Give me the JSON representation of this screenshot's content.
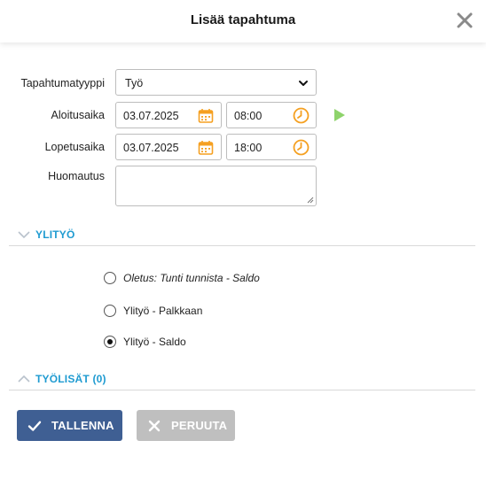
{
  "dialog": {
    "title": "Lisää tapahtuma",
    "close_icon": "close-icon"
  },
  "form": {
    "event_type_label": "Tapahtumatyyppi",
    "event_type_value": "Työ",
    "start_label": "Aloitusaika",
    "start_date": "03.07.2025",
    "start_time": "08:00",
    "end_label": "Lopetusaika",
    "end_date": "03.07.2025",
    "end_time": "18:00",
    "note_label": "Huomautus",
    "note_value": ""
  },
  "overtime": {
    "title": "YLITYÖ",
    "options": [
      {
        "label": "Oletus: Tunti tunnista - Saldo",
        "checked": false,
        "italic": true
      },
      {
        "label": "Ylityö - Palkkaan",
        "checked": false,
        "italic": false
      },
      {
        "label": "Ylityö - Saldo",
        "checked": true,
        "italic": false
      }
    ]
  },
  "supplements": {
    "title": "TYÖLISÄT (0)"
  },
  "actions": {
    "save_label": "TALLENNA",
    "cancel_label": "PERUUTA"
  },
  "colors": {
    "accent": "#1f9bd1",
    "save_button": "#3f5f93",
    "cancel_button": "#bfbfbf",
    "icon_orange": "#f5a021",
    "play_green": "#8ed36b"
  }
}
